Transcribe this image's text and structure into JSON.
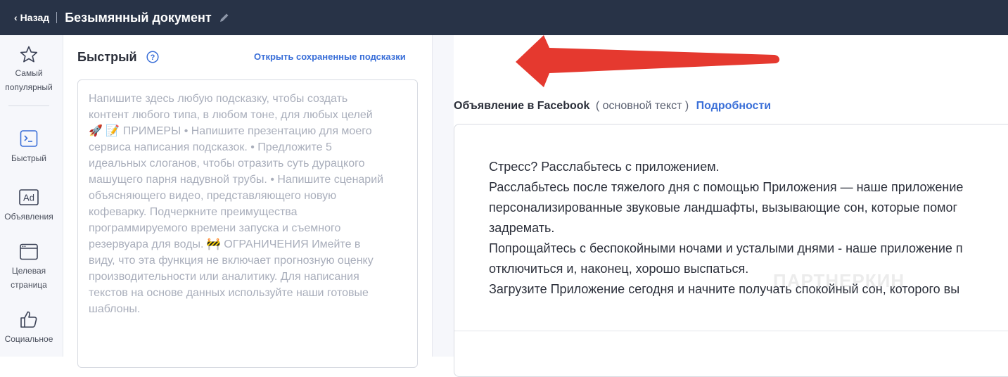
{
  "header": {
    "back_label": "Назад",
    "title": "Безымянный документ"
  },
  "rail": {
    "items": [
      {
        "label_line1": "Самый",
        "label_line2": "популярный",
        "icon": "star-icon"
      },
      {
        "label_line1": "Быстрый",
        "icon": "terminal-icon"
      },
      {
        "label_line1": "Объявления",
        "icon": "ad-icon"
      },
      {
        "label_line1": "Целевая",
        "label_line2": "страница",
        "icon": "browser-window-icon"
      },
      {
        "label_line1": "Социальное",
        "icon": "thumbs-up-icon"
      }
    ]
  },
  "panel": {
    "title": "Быстрый",
    "saved_link": "Открыть сохраненные подсказки",
    "placeholder_lines": [
      "Напишите здесь любую подсказку, чтобы создать",
      "контент любого типа, в любом тоне, для любых целей",
      "🚀 📝 ПРИМЕРЫ • Напишите презентацию для моего",
      "сервиса написания подсказок.  • Предложите 5",
      "идеальных слоганов, чтобы отразить суть дурацкого",
      "машущего парня надувной трубы.  • Напишите сценарий",
      "объясняющего видео, представляющего новую",
      "кофеварку.  Подчеркните преимущества",
      "программируемого времени запуска и съемного",
      "резервуара для воды.  🚧 ОГРАНИЧЕНИЯ Имейте в",
      "виду, что эта функция не включает прогнозную оценку",
      "производительности или аналитику.  Для написания",
      "текстов на основе данных используйте наши готовые",
      "шаблоны."
    ]
  },
  "result": {
    "header_main": "Объявление в Facebook",
    "header_sub": "( основной текст )",
    "header_link": "Подробности",
    "lines": [
      "Стресс? Расслабьтесь с приложением.",
      "Расслабьтесь после тяжелого дня с помощью Приложения — наше приложение",
      "персонализированные звуковые ландшафты, вызывающие сон, которые помог",
      "задремать.",
      "Попрощайтесь с беспокойными ночами и усталыми днями - наше приложение п",
      "отключиться и, наконец, хорошо выспаться.",
      "Загрузите Приложение сегодня и начните получать спокойный сон, которого вы"
    ],
    "watermark": "ПАРТНЕРКИН"
  },
  "colors": {
    "topbar": "#283347",
    "accent": "#3a6fd8",
    "arrow": "#e5392f"
  }
}
